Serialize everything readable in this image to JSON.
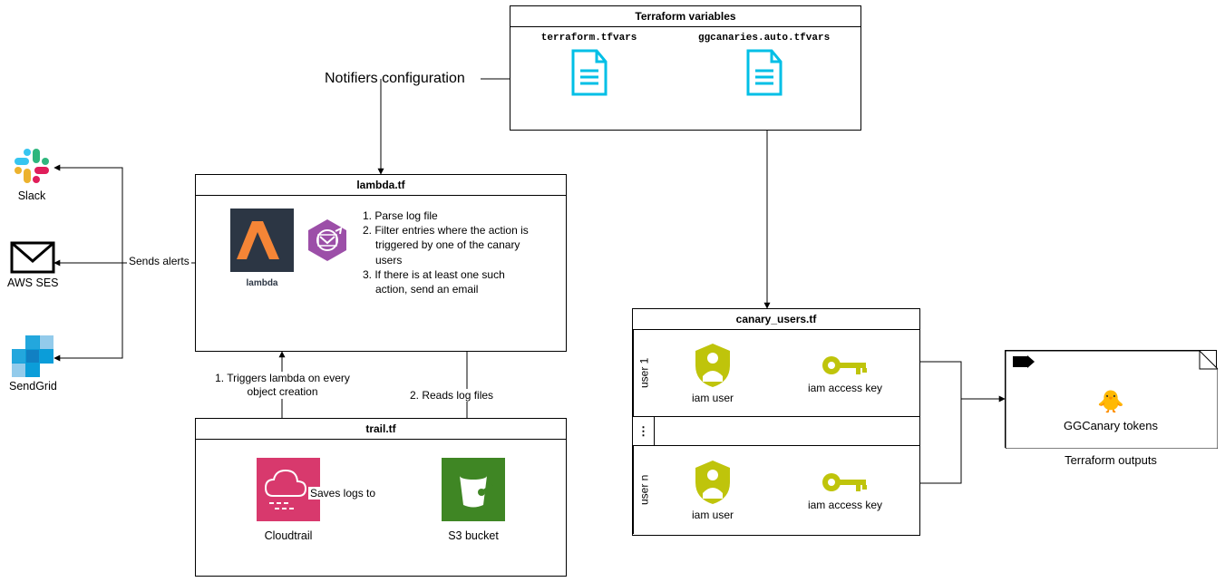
{
  "tfvars_box": {
    "title": "Terraform variables",
    "file1": "terraform.tfvars",
    "file2": "ggcanaries.auto.tfvars"
  },
  "notifiers_label": "Notifiers configuration",
  "lambda_box": {
    "title": "lambda.tf",
    "icon_caption": "lambda",
    "steps": [
      "1. Parse log file",
      "2. Filter entries where the action is triggered by one of the canary users",
      "3. If there is at least one such action, send an email"
    ]
  },
  "trail_box": {
    "title": "trail.tf",
    "cloudtrail_caption": "Cloudtrail",
    "s3_caption": "S3 bucket"
  },
  "canary_box": {
    "title": "canary_users.tf",
    "user1_label": "user 1",
    "usern_label": "user n",
    "dots": "⋮",
    "iam_user_caption": "iam user",
    "iam_key_caption": "iam access key"
  },
  "outputs_box": {
    "title": "GGCanary tokens",
    "caption": "Terraform outputs"
  },
  "alerts": {
    "slack": "Slack",
    "ses": "AWS SES",
    "sendgrid": "SendGrid",
    "sends_alerts": "Sends alerts"
  },
  "edges": {
    "triggers": "1. Triggers lambda\non every object creation",
    "reads": "2. Reads log files",
    "saves": "Saves logs to"
  }
}
